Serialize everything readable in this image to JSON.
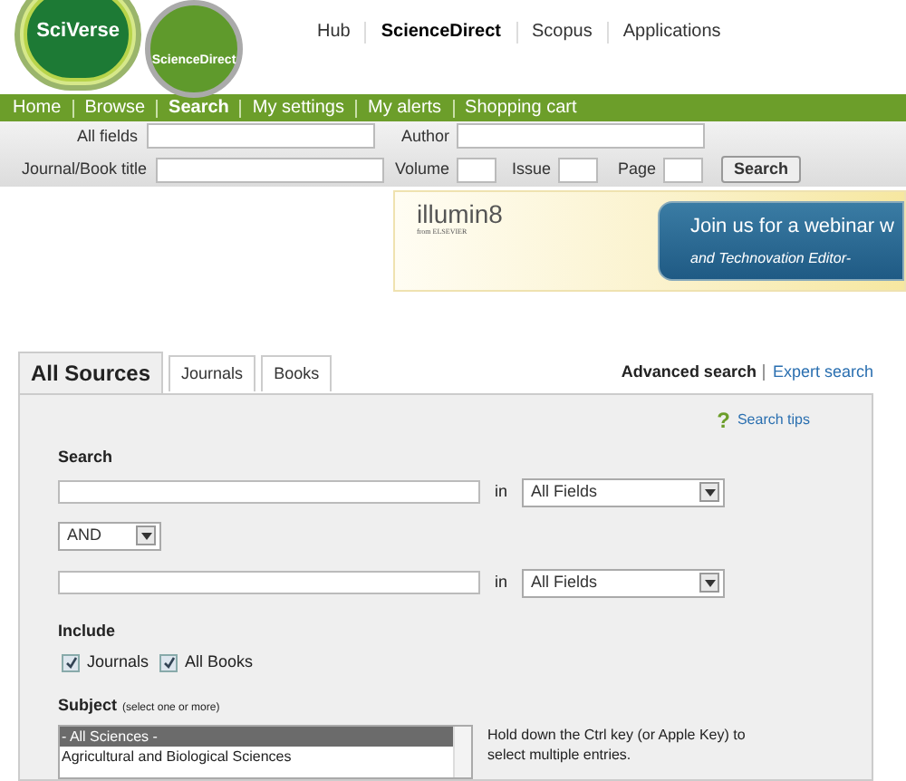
{
  "logo": {
    "brand": "SciVerse",
    "product": "ScienceDirect"
  },
  "top_links": [
    {
      "label": "Hub",
      "selected": false
    },
    {
      "label": "ScienceDirect",
      "selected": true
    },
    {
      "label": "Scopus",
      "selected": false
    },
    {
      "label": "Applications",
      "selected": false
    }
  ],
  "nav": [
    {
      "label": "Home",
      "selected": false
    },
    {
      "label": "Browse",
      "selected": false
    },
    {
      "label": "Search",
      "selected": true
    },
    {
      "label": "My settings",
      "selected": false
    },
    {
      "label": "My alerts",
      "selected": false
    },
    {
      "label": "Shopping cart",
      "selected": false
    }
  ],
  "quick_search": {
    "all_fields": "All fields",
    "author": "Author",
    "title": "Journal/Book title",
    "volume": "Volume",
    "issue": "Issue",
    "page": "Page",
    "button": "Search"
  },
  "banner": {
    "brand": "illumin8",
    "brand_sub": "from ELSEVIER",
    "line_1": "Join us for a webinar w",
    "line_2": "and *Technovation* Editor-"
  },
  "tabs": [
    {
      "label": "All Sources",
      "selected": true
    },
    {
      "label": "Journals",
      "selected": false
    },
    {
      "label": "Books",
      "selected": false
    }
  ],
  "search_modes": [
    {
      "label": "Advanced search",
      "selected": true
    },
    {
      "label": "Expert search",
      "selected": false
    }
  ],
  "help_mark": "?",
  "search_tips": "Search tips",
  "search_label": "Search",
  "in_label_1": "in",
  "field_select_1": "All Fields",
  "operator": "AND",
  "in_label_2": "in",
  "field_select_2": "All Fields",
  "include": {
    "label": "Include",
    "options": [
      {
        "label": "Journals",
        "checked": true
      },
      {
        "label": "All Books",
        "checked": true
      }
    ]
  },
  "subject": {
    "label": "Subject",
    "hint": "(select one or more)",
    "items": [
      {
        "label": "- All Sciences -",
        "selected": true
      },
      {
        "label": "Agricultural and Biological Sciences",
        "selected": false
      }
    ],
    "help": "Hold down the Ctrl key (or Apple Key) to select multiple entries."
  }
}
